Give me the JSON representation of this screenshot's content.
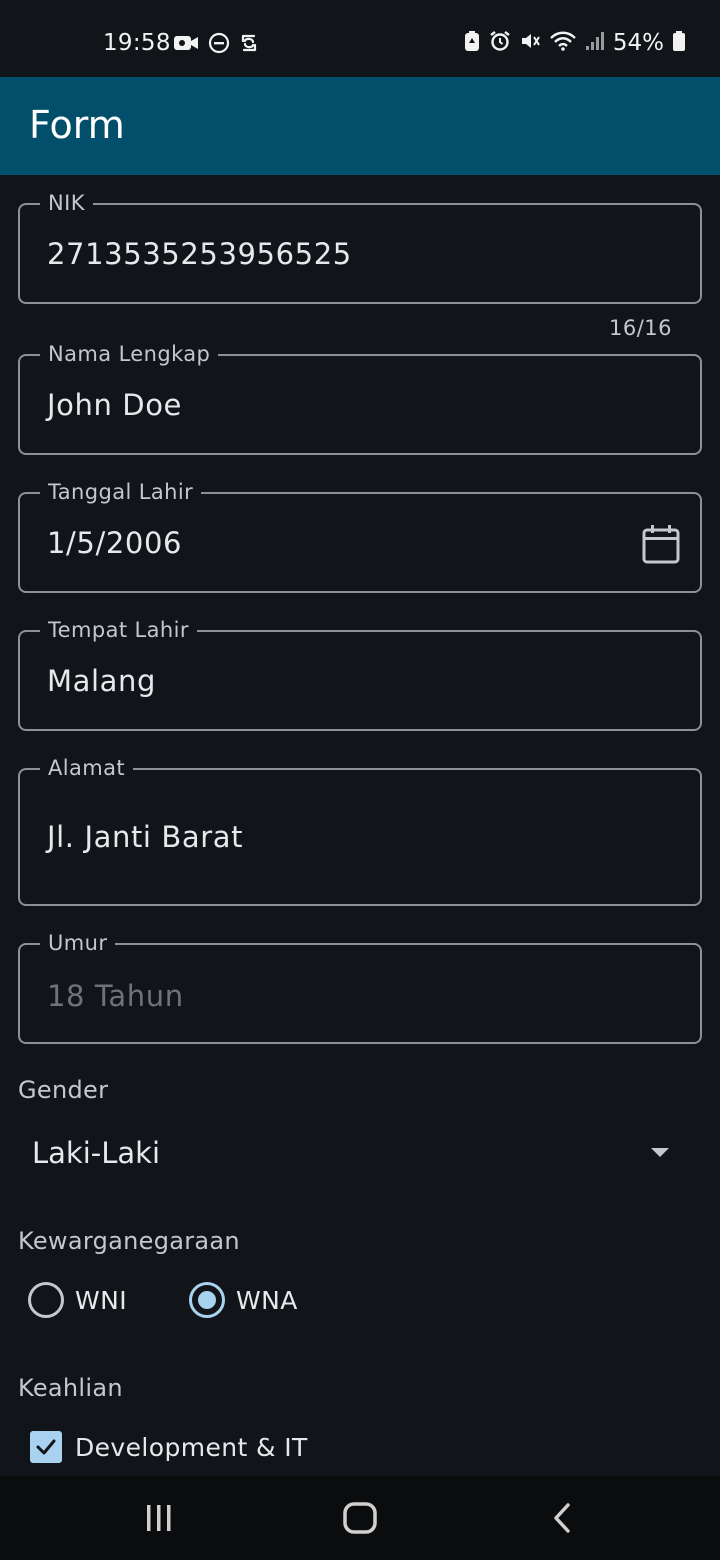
{
  "status_bar": {
    "time": "19:58",
    "battery_percent": "54%",
    "left_icons": [
      "video-camera-icon",
      "do-not-disturb-icon",
      "sync-icon"
    ],
    "right_icons": [
      "battery-saver-icon",
      "alarm-icon",
      "vibrate-off-icon",
      "wifi-icon",
      "signal-icon",
      "battery-icon"
    ]
  },
  "app_bar": {
    "title": "Form"
  },
  "form": {
    "nik": {
      "label": "NIK",
      "value": "2713535253956525",
      "counter": "16/16"
    },
    "nama_lengkap": {
      "label": "Nama Lengkap",
      "value": "John Doe"
    },
    "tanggal_lahir": {
      "label": "Tanggal Lahir",
      "value": "1/5/2006",
      "icon": "calendar-icon"
    },
    "tempat_lahir": {
      "label": "Tempat Lahir",
      "value": "Malang"
    },
    "alamat": {
      "label": "Alamat",
      "value": "Jl. Janti Barat"
    },
    "umur": {
      "label": "Umur",
      "value": "18 Tahun",
      "disabled": true
    },
    "gender": {
      "label": "Gender",
      "selected": "Laki-Laki"
    },
    "kewarganegaraan": {
      "label": "Kewarganegaraan",
      "options": [
        {
          "label": "WNI",
          "checked": false
        },
        {
          "label": "WNA",
          "checked": true
        }
      ]
    },
    "keahlian": {
      "label": "Keahlian",
      "options": [
        {
          "label": "Development & IT",
          "checked": true
        }
      ]
    }
  },
  "nav_bar": {
    "buttons": [
      "recents-button",
      "home-button",
      "back-button"
    ]
  },
  "colors": {
    "background": "#111418",
    "app_bar": "#014f6a",
    "accent": "#a9d2f1",
    "outline": "#8c9198"
  }
}
